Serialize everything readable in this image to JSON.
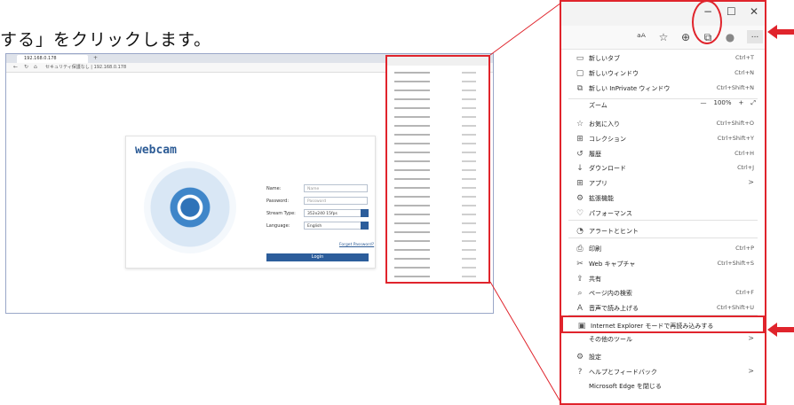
{
  "instruction_text": "する」をクリックします。",
  "small_browser": {
    "tab_title": "192.168.0.178",
    "tab_plus": "+",
    "address_text": "セキュリティ保護なし  |  192.168.0.178",
    "brand": "webcam",
    "login_labels": [
      "Name:",
      "Password:",
      "Stream Type:",
      "Language:"
    ],
    "login_values": [
      "Name",
      "Password",
      "352x240 15fps",
      "English"
    ],
    "forgot_password": "Forget Password?",
    "login_button": "Login"
  },
  "menu": {
    "window_controls": {
      "minimize": "−",
      "maximize": "☐",
      "close": "✕"
    },
    "more_button": "...",
    "items": [
      {
        "icon": "new-tab-icon",
        "glyph": "▭",
        "label": "新しいタブ",
        "shortcut": "Ctrl+T"
      },
      {
        "icon": "new-window-icon",
        "glyph": "▢",
        "label": "新しいウィンドウ",
        "shortcut": "Ctrl+N"
      },
      {
        "icon": "inprivate-window-icon",
        "glyph": "⧉",
        "label": "新しい InPrivate ウィンドウ",
        "shortcut": "Ctrl+Shift+N"
      },
      {
        "icon": "favorites-icon",
        "glyph": "☆",
        "label": "お気に入り",
        "shortcut": "Ctrl+Shift+O"
      },
      {
        "icon": "collections-icon",
        "glyph": "⊞",
        "label": "コレクション",
        "shortcut": "Ctrl+Shift+Y"
      },
      {
        "icon": "history-icon",
        "glyph": "↺",
        "label": "履歴",
        "shortcut": "Ctrl+H"
      },
      {
        "icon": "download-icon",
        "glyph": "↓",
        "label": "ダウンロード",
        "shortcut": "Ctrl+J"
      },
      {
        "icon": "apps-icon",
        "glyph": "⊞",
        "label": "アプリ",
        "submenu": ">"
      },
      {
        "icon": "extensions-icon",
        "glyph": "⚙",
        "label": "拡張機能"
      },
      {
        "icon": "performance-icon",
        "glyph": "♡",
        "label": "パフォーマンス"
      },
      {
        "icon": "alerts-icon",
        "glyph": "◔",
        "label": "アラートとヒント"
      },
      {
        "icon": "print-icon",
        "glyph": "⎙",
        "label": "印刷",
        "shortcut": "Ctrl+P"
      },
      {
        "icon": "web-capture-icon",
        "glyph": "✂",
        "label": "Web キャプチャ",
        "shortcut": "Ctrl+Shift+S"
      },
      {
        "icon": "share-icon",
        "glyph": "⇪",
        "label": "共有"
      },
      {
        "icon": "find-icon",
        "glyph": "⌕",
        "label": "ページ内の検索",
        "shortcut": "Ctrl+F"
      },
      {
        "icon": "read-aloud-icon",
        "glyph": "A",
        "label": "音声で読み上げる",
        "shortcut": "Ctrl+Shift+U"
      },
      {
        "icon": "ie-mode-icon",
        "glyph": "▣",
        "label": "Internet Explorer モードで再読み込みする"
      },
      {
        "icon": "",
        "glyph": "",
        "label": "その他のツール",
        "submenu": ">"
      },
      {
        "icon": "settings-icon",
        "glyph": "⚙",
        "label": "設定"
      },
      {
        "icon": "help-icon",
        "glyph": "?",
        "label": "ヘルプとフィードバック",
        "submenu": ">"
      },
      {
        "icon": "",
        "glyph": "",
        "label": "Microsoft Edge を閉じる"
      }
    ],
    "zoom": {
      "label": "ズーム",
      "minus": "—",
      "value": "100%",
      "plus": "+",
      "fullscreen": "⤢"
    }
  },
  "colors": {
    "highlight": "#e0242c",
    "brand_blue": "#2c5d9b"
  }
}
